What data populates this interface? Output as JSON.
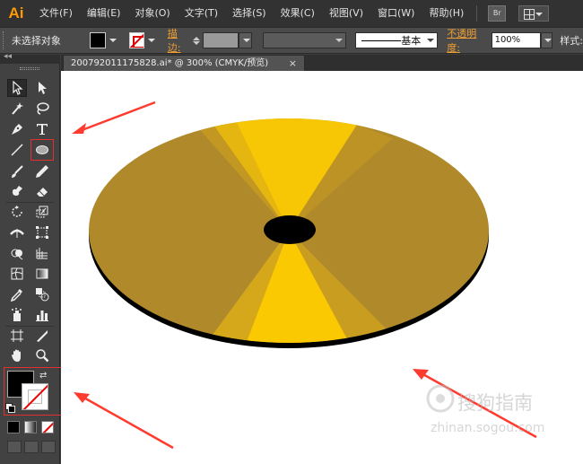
{
  "app": {
    "logo": "Ai",
    "br_button": "Br"
  },
  "menu": [
    "文件(F)",
    "编辑(E)",
    "对象(O)",
    "文字(T)",
    "选择(S)",
    "效果(C)",
    "视图(V)",
    "窗口(W)",
    "帮助(H)"
  ],
  "control_bar": {
    "selection_status": "未选择对象",
    "stroke_label": "描边:",
    "brush_label": "基本",
    "opacity_label": "不透明度:",
    "opacity_value": "100%",
    "style_label": "样式:"
  },
  "document_tab": {
    "title": "200792011175828.ai* @ 300% (CMYK/预览)",
    "close": "×"
  },
  "toolbox": {
    "collapse": "◂◂",
    "tools": [
      "selection-tool",
      "direct-selection-tool",
      "magic-wand-tool",
      "lasso-tool",
      "pen-tool",
      "type-tool",
      "line-segment-tool",
      "ellipse-tool",
      "paintbrush-tool",
      "pencil-tool",
      "blob-brush-tool",
      "eraser-tool",
      "rotate-tool",
      "scale-tool",
      "width-tool",
      "free-transform-tool",
      "shape-builder-tool",
      "perspective-grid-tool",
      "mesh-tool",
      "gradient-tool",
      "eyedropper-tool",
      "blend-tool",
      "symbol-sprayer-tool",
      "column-graph-tool",
      "artboard-tool",
      "slice-tool",
      "hand-tool",
      "zoom-tool"
    ],
    "active_tool": "selection-tool",
    "highlighted_tool": "ellipse-tool",
    "fill_color": "#000000",
    "stroke": "none"
  },
  "canvas": {
    "background": "#ffffff",
    "disc_color": "#b08a2a",
    "disc_highlight": "#ffcc00",
    "hole_color": "#000000"
  },
  "watermark": {
    "brand": "搜狗指南",
    "url": "zhinan.sogou.com"
  },
  "annotation_color": "#ff3b2f"
}
